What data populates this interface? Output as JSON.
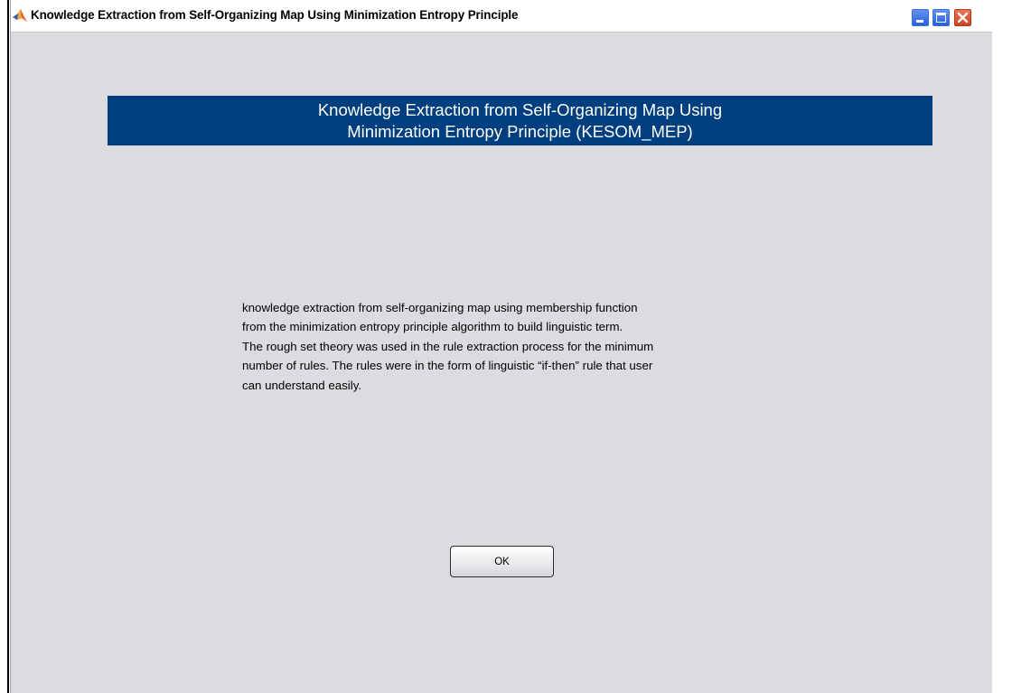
{
  "window": {
    "title": "Knowledge Extraction from Self-Organizing Map Using Minimization Entropy Principle",
    "icon": "matlab-icon",
    "controls": [
      "minimize-icon",
      "maximize-icon",
      "close-icon"
    ]
  },
  "banner": {
    "line1": "Knowledge Extraction from Self-Organizing Map Using",
    "line2": "Minimization Entropy Principle (KESOM_MEP)",
    "background": "#003f7f"
  },
  "description": {
    "lines": [
      "knowledge extraction from self-organizing map using membership function",
      "from the minimization entropy principle algorithm to build linguistic term.",
      "The rough set theory was used in the rule extraction process for the minimum",
      "number of rules. The rules were in the form of linguistic “if-then” rule that user",
      "can understand easily."
    ]
  },
  "ok_button": {
    "label": "OK"
  }
}
